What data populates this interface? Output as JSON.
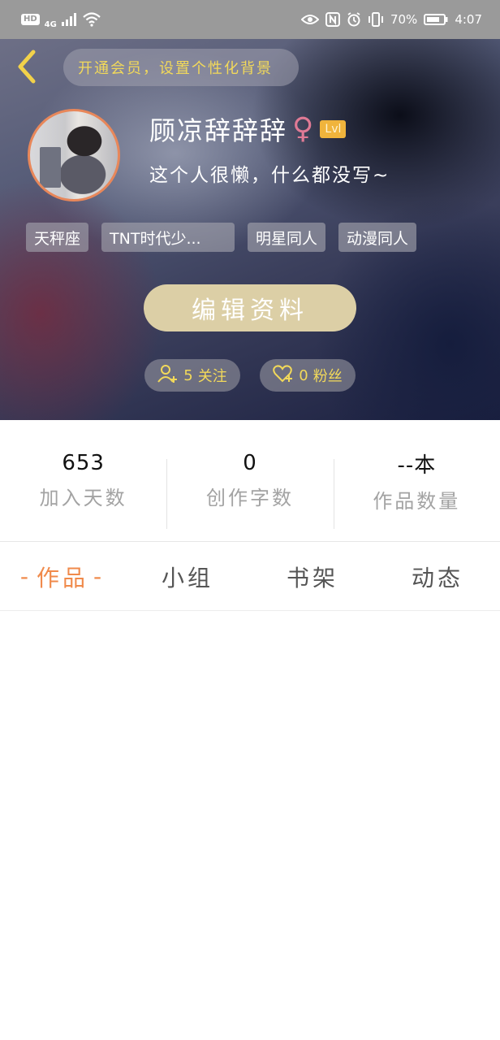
{
  "status_bar": {
    "hd_label": "HD",
    "network_label": "4G",
    "battery_percent": "70%",
    "time": "4:07",
    "icons": [
      "signal-icon",
      "wifi-icon",
      "eye-comfort-icon",
      "nfc-icon",
      "alarm-icon",
      "vibrate-icon",
      "battery-icon"
    ]
  },
  "header": {
    "back_icon": "chevron-left-icon",
    "vip_banner": "开通会员，设置个性化背景"
  },
  "profile": {
    "username": "顾凉辞辞辞",
    "gender_symbol": "♀",
    "level_badge": "Lvl",
    "bio": "这个人很懒，什么都没写~",
    "tags": [
      "天秤座",
      "TNT时代少...",
      "明星同人",
      "动漫同人"
    ],
    "edit_button": "编辑资料",
    "follow_count": "5",
    "follow_label": "关注",
    "fans_count": "0",
    "fans_label": "粉丝"
  },
  "stats": [
    {
      "value": "653",
      "label": "加入天数"
    },
    {
      "value": "0",
      "label": "创作字数"
    },
    {
      "value": "--本",
      "label": "作品数量"
    }
  ],
  "tabs": [
    {
      "label": "作品",
      "active": true
    },
    {
      "label": "小组",
      "active": false
    },
    {
      "label": "书架",
      "active": false
    },
    {
      "label": "动态",
      "active": false
    }
  ],
  "colors": {
    "accent": "#f08a4b",
    "gold_text": "#f2d95a",
    "edit_button_bg": "#dccfa6",
    "level_badge_bg": "#f0b43c"
  }
}
